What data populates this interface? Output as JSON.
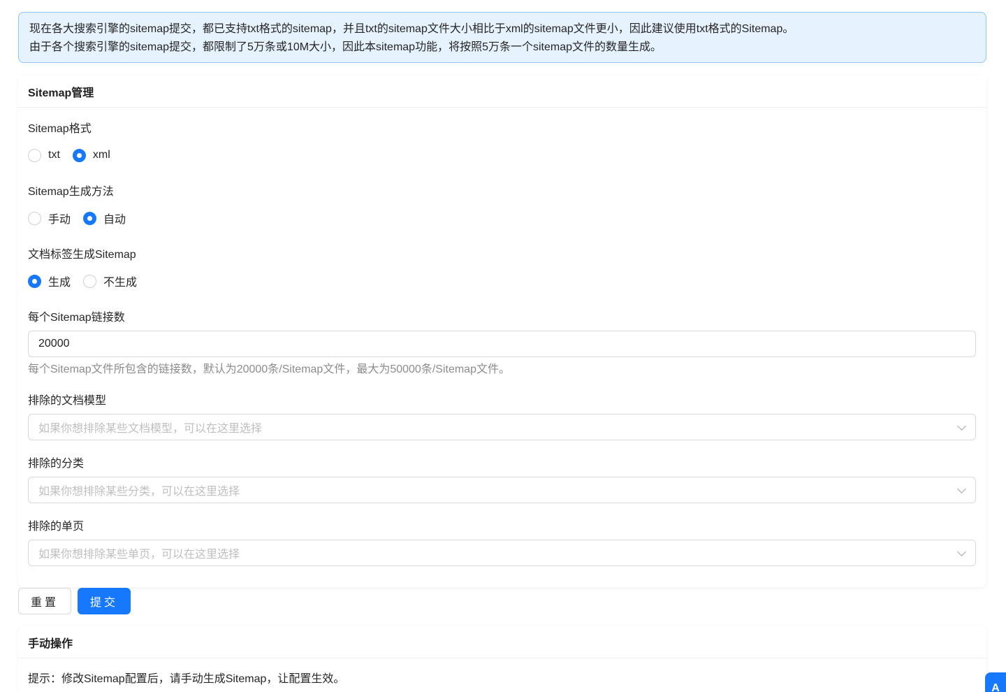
{
  "alert": {
    "line1": "现在各大搜索引擎的sitemap提交，都已支持txt格式的sitemap，并且txt的sitemap文件大小相比于xml的sitemap文件更小，因此建议使用txt格式的Sitemap。",
    "line2": "由于各个搜索引擎的sitemap提交，都限制了5万条或10M大小，因此本sitemap功能，将按照5万条一个sitemap文件的数量生成。"
  },
  "sitemap_card": {
    "title": "Sitemap管理",
    "format": {
      "label": "Sitemap格式",
      "options": [
        "txt",
        "xml"
      ],
      "selected": "xml"
    },
    "method": {
      "label": "Sitemap生成方法",
      "options": [
        "手动",
        "自动"
      ],
      "selected": "自动"
    },
    "tag_sitemap": {
      "label": "文档标签生成Sitemap",
      "options": [
        "生成",
        "不生成"
      ],
      "selected": "生成"
    },
    "links_per_sitemap": {
      "label": "每个Sitemap链接数",
      "value": "20000",
      "help": "每个Sitemap文件所包含的链接数，默认为20000条/Sitemap文件，最大为50000条/Sitemap文件。"
    },
    "exclude_models": {
      "label": "排除的文档模型",
      "placeholder": "如果你想排除某些文档模型，可以在这里选择"
    },
    "exclude_categories": {
      "label": "排除的分类",
      "placeholder": "如果你想排除某些分类，可以在这里选择"
    },
    "exclude_pages": {
      "label": "排除的单页",
      "placeholder": "如果你想排除某些单页，可以在这里选择"
    }
  },
  "buttons": {
    "reset": "重置",
    "submit": "提交"
  },
  "manual_card": {
    "title": "手动操作",
    "tip": "提示：修改Sitemap配置后，请手动生成Sitemap，让配置生效。"
  },
  "float_button": {
    "label": "A"
  },
  "colors": {
    "primary": "#1677ff",
    "alert_bg": "#e6f2fd",
    "alert_border": "#8fc5f4"
  }
}
